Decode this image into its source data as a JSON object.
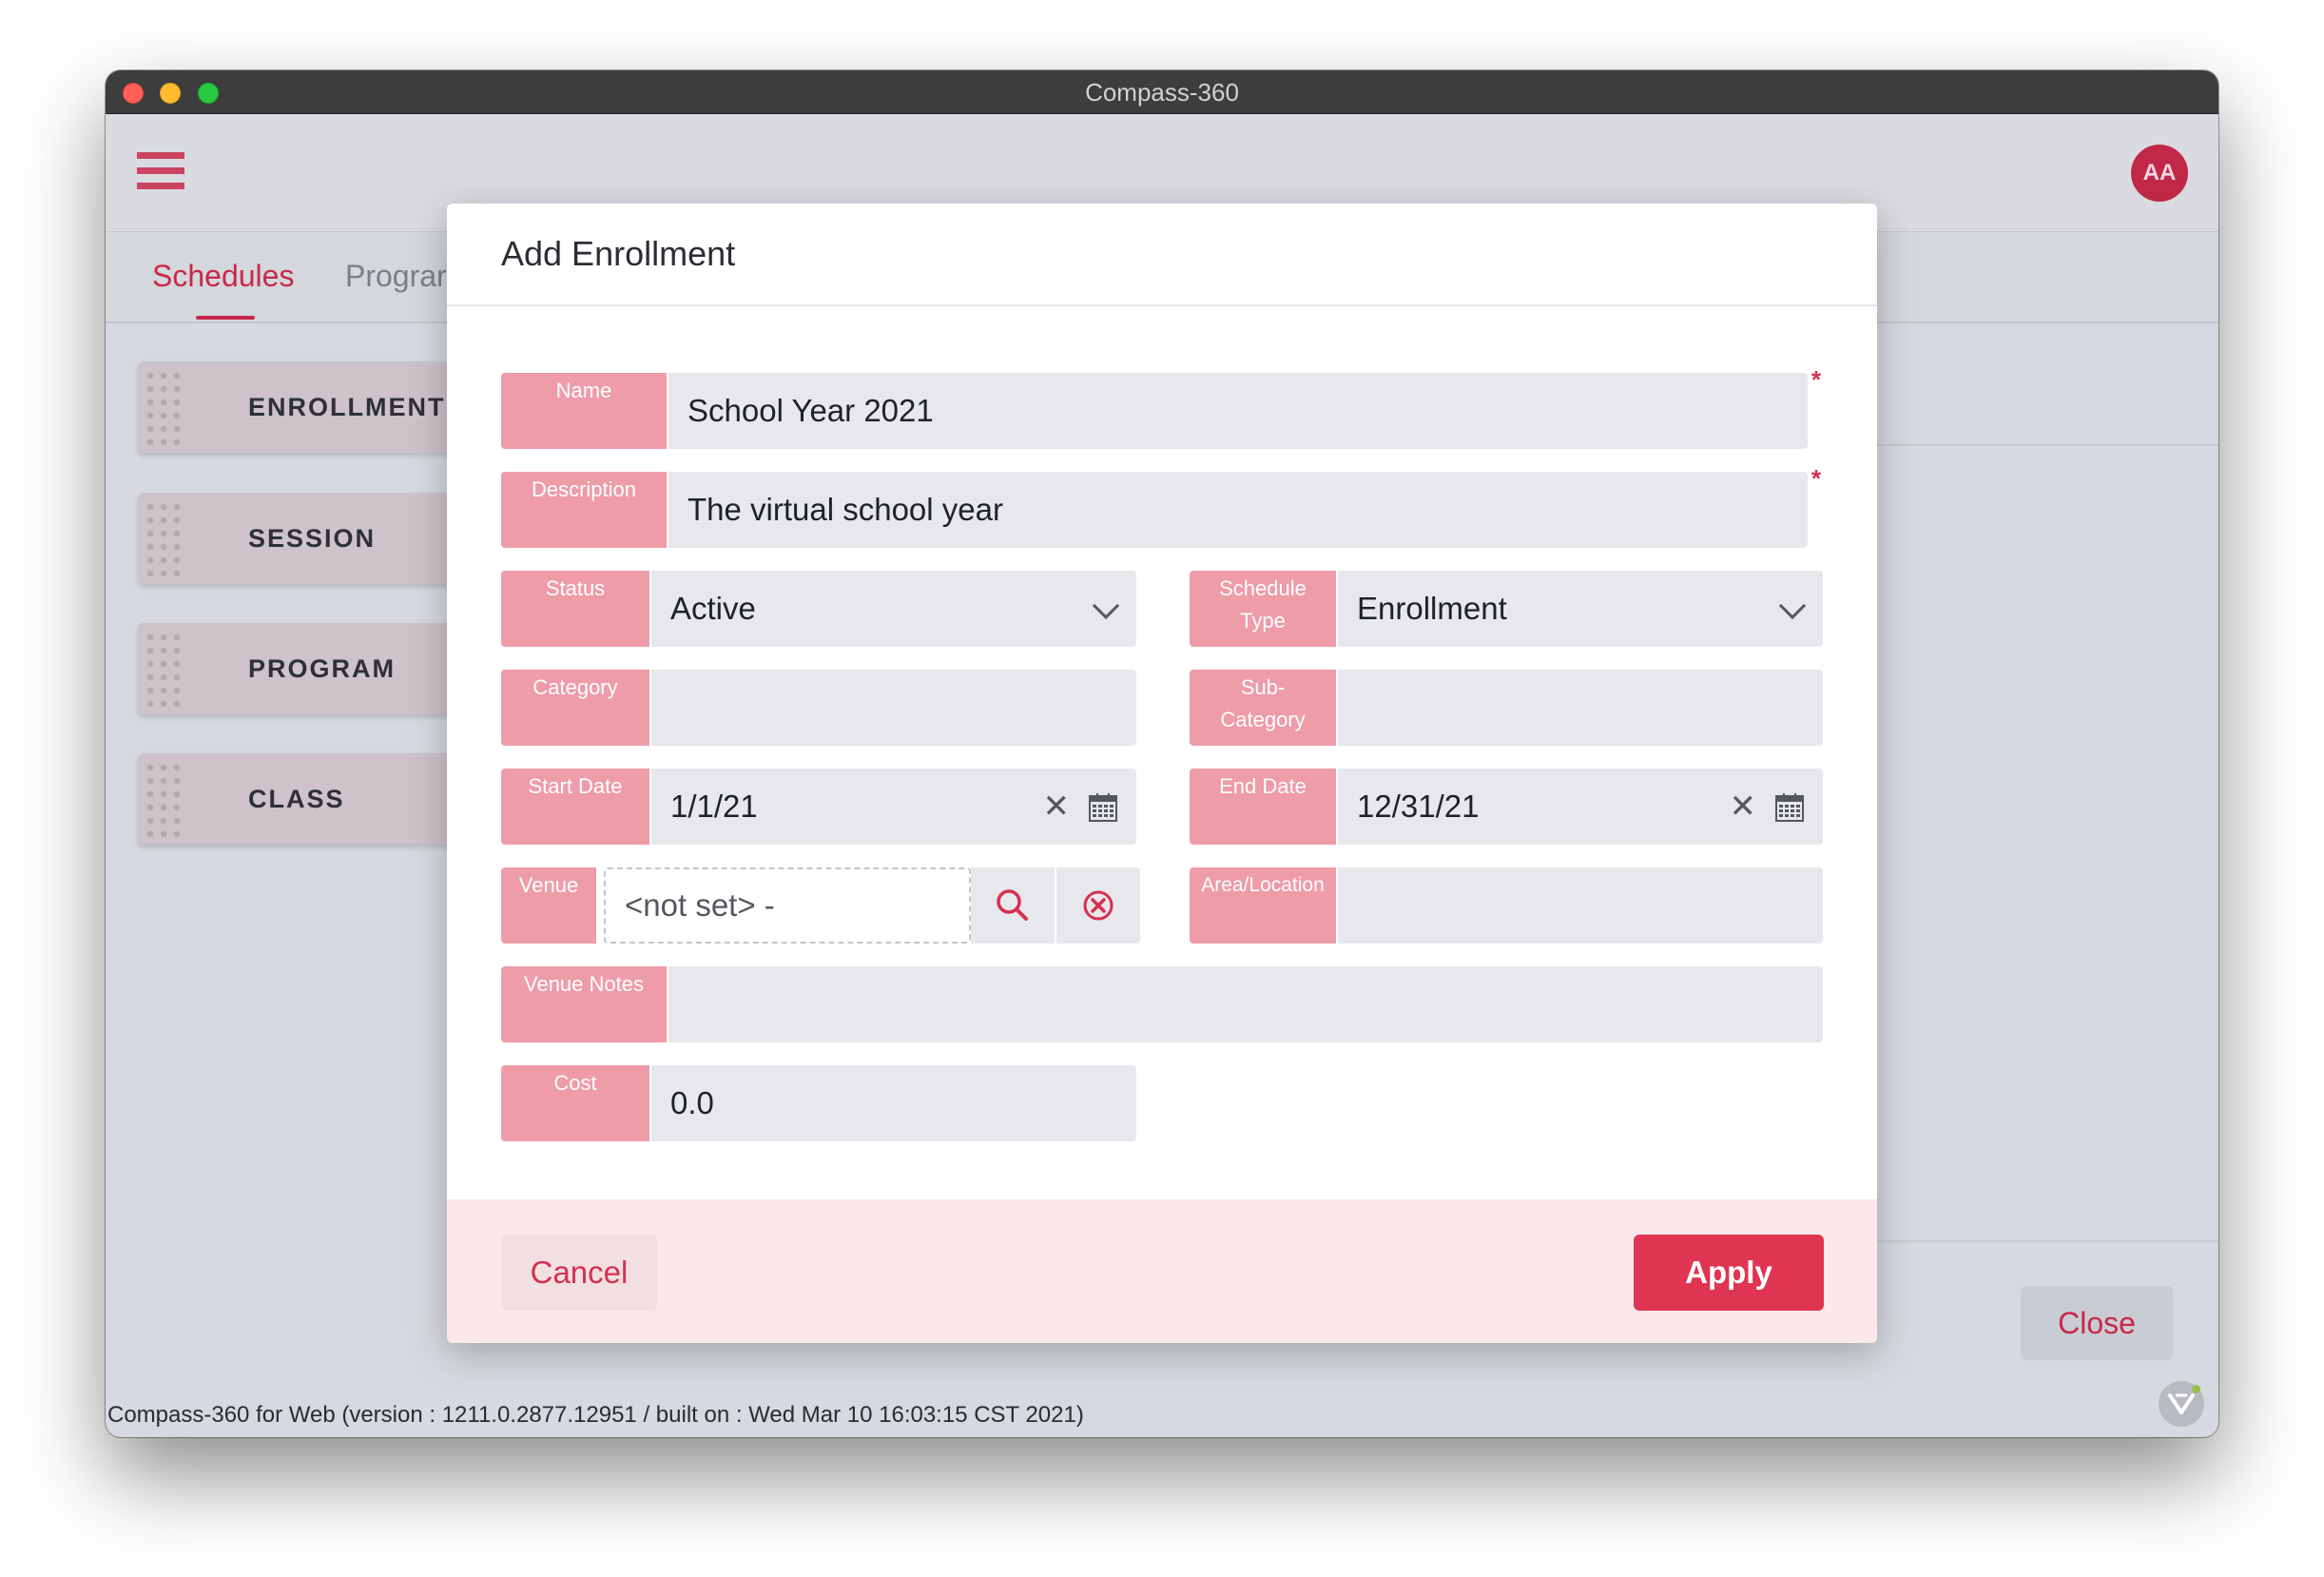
{
  "window": {
    "title": "Compass-360"
  },
  "app": {
    "avatar_initials": "AA",
    "tabs": [
      {
        "label": "Schedules"
      },
      {
        "label": "Prograr"
      }
    ],
    "sidebar": [
      {
        "label": "ENROLLMENT"
      },
      {
        "label": "SESSION"
      },
      {
        "label": "PROGRAM"
      },
      {
        "label": "CLASS"
      }
    ],
    "close_label": "Close",
    "footer": "Compass-360 for Web (version : 1211.0.2877.12951 / built on : Wed Mar 10 16:03:15 CST 2021)"
  },
  "dialog": {
    "title": "Add Enrollment",
    "fields": {
      "name": {
        "label": "Name",
        "value": "School Year 2021",
        "required_mark": "*"
      },
      "description": {
        "label": "Description",
        "value": "The virtual school year",
        "required_mark": "*"
      },
      "status": {
        "label": "Status",
        "value": "Active"
      },
      "schedule_type": {
        "label_line1": "Schedule",
        "label_line2": "Type",
        "value": "Enrollment"
      },
      "category": {
        "label": "Category",
        "value": ""
      },
      "sub_category": {
        "label_line1": "Sub-",
        "label_line2": "Category",
        "value": ""
      },
      "start_date": {
        "label": "Start Date",
        "value": "1/1/21"
      },
      "end_date": {
        "label": "End Date",
        "value": "12/31/21"
      },
      "venue": {
        "label": "Venue",
        "value": "<not set> -"
      },
      "area_location": {
        "label": "Area/Location",
        "value": ""
      },
      "venue_notes": {
        "label": "Venue Notes",
        "value": ""
      },
      "cost": {
        "label": "Cost",
        "value": "0.0"
      }
    },
    "cancel_label": "Cancel",
    "apply_label": "Apply"
  },
  "colors": {
    "accent": "#c8284a",
    "label_bg": "#ee9ca8",
    "apply_bg": "#df3552",
    "footer_bg": "#fbe8ea"
  },
  "icons": [
    "hamburger-menu-icon",
    "chevron-down-icon",
    "clear-x-icon",
    "calendar-icon",
    "search-icon",
    "clear-circle-icon",
    "vaadin-logo-icon"
  ]
}
